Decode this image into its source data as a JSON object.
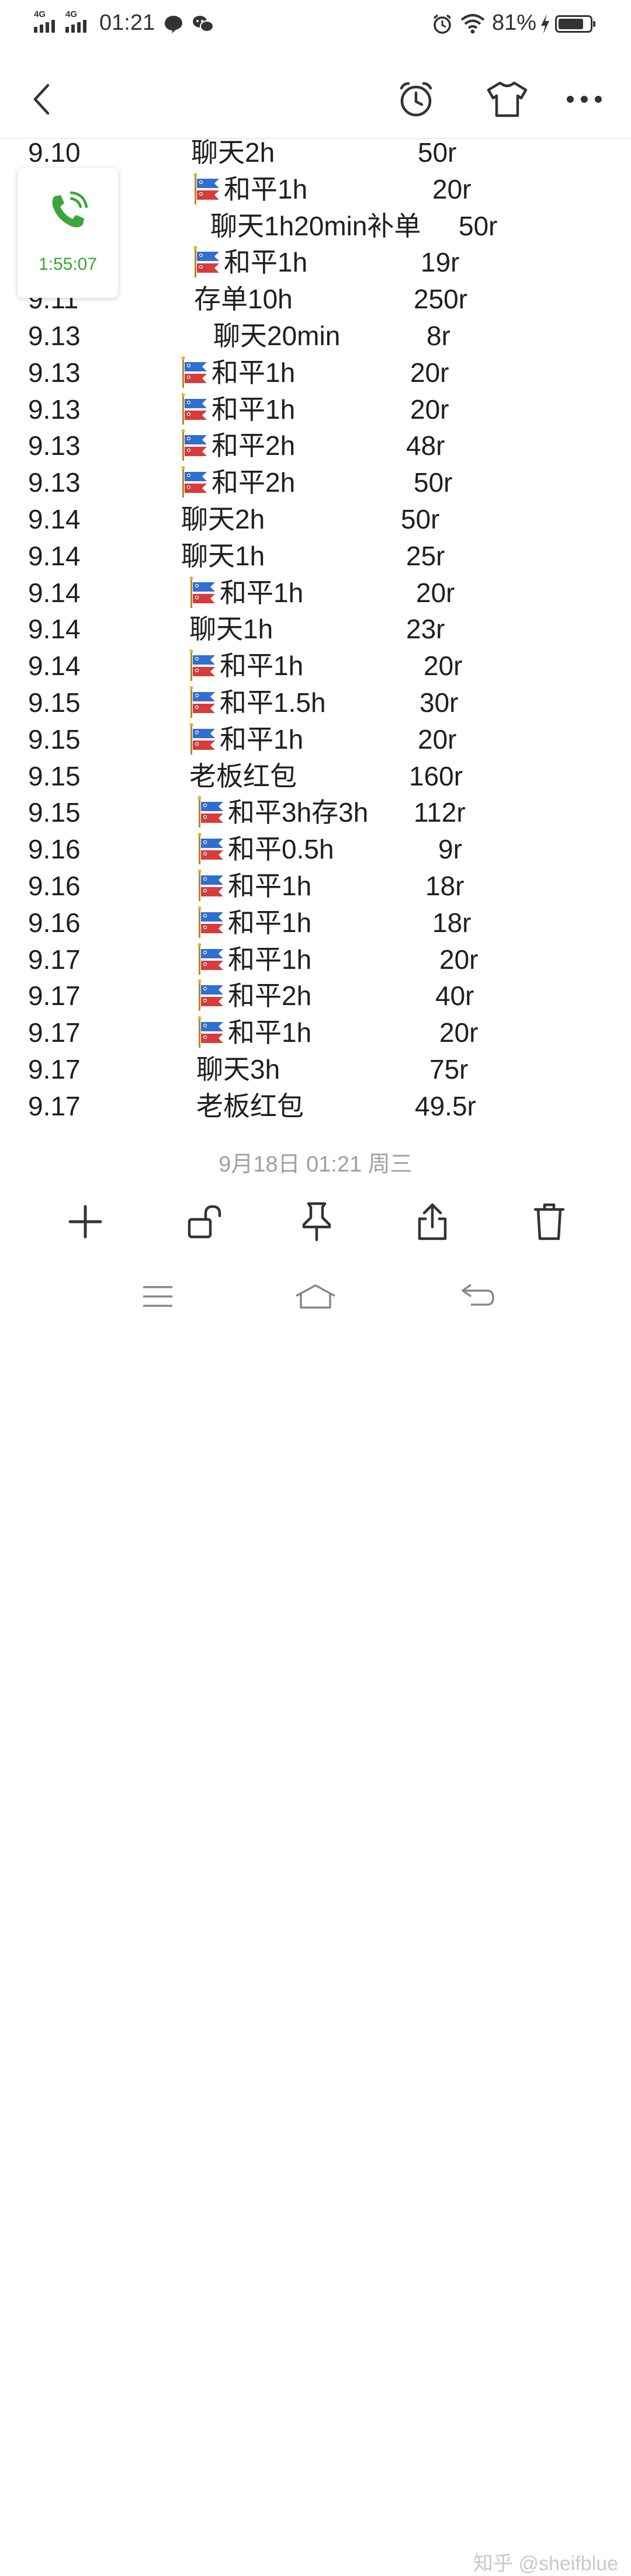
{
  "status_bar": {
    "network1": "4G",
    "network2": "4G",
    "time": "01:21",
    "battery_percent": "81%",
    "battery_level": 0.81
  },
  "call_widget": {
    "timer": "1:55:07",
    "accent": "#3aa53a"
  },
  "header_icons": [
    "back-arrow-icon",
    "alarm-clock-icon",
    "tshirt-icon",
    "more-dots-icon"
  ],
  "note": {
    "rows": [
      {
        "date": "9.10",
        "item": "聊天2h",
        "amount": "50r",
        "flag": false
      },
      {
        "date": "",
        "item": "和平1h",
        "amount": "20r",
        "flag": true
      },
      {
        "date": "",
        "item": "聊天1h20min补单",
        "amount": "50r",
        "flag": false
      },
      {
        "date": "",
        "item": "和平1h",
        "amount": "19r",
        "flag": true
      },
      {
        "date": "9.11",
        "item": "存单10h",
        "amount": "250r",
        "flag": false
      },
      {
        "date": "9.13",
        "item": "聊天20min",
        "amount": "8r",
        "flag": false
      },
      {
        "date": "9.13",
        "item": "和平1h",
        "amount": "20r",
        "flag": true
      },
      {
        "date": "9.13",
        "item": "和平1h",
        "amount": "20r",
        "flag": true
      },
      {
        "date": "9.13",
        "item": "和平2h",
        "amount": "48r",
        "flag": true
      },
      {
        "date": "9.13",
        "item": "和平2h",
        "amount": "50r",
        "flag": true
      },
      {
        "date": "9.14",
        "item": "聊天2h",
        "amount": "50r",
        "flag": false
      },
      {
        "date": "9.14",
        "item": "聊天1h",
        "amount": "25r",
        "flag": false
      },
      {
        "date": "9.14",
        "item": "和平1h",
        "amount": "20r",
        "flag": true
      },
      {
        "date": "9.14",
        "item": "聊天1h",
        "amount": "23r",
        "flag": false
      },
      {
        "date": "9.14",
        "item": "和平1h",
        "amount": "20r",
        "flag": true
      },
      {
        "date": "9.15",
        "item": "和平1.5h",
        "amount": "30r",
        "flag": true
      },
      {
        "date": "9.15",
        "item": "和平1h",
        "amount": "20r",
        "flag": true
      },
      {
        "date": "9.15",
        "item": "老板红包",
        "amount": "160r",
        "flag": false
      },
      {
        "date": "9.15",
        "item": "和平3h存3h",
        "amount": "112r",
        "flag": true
      },
      {
        "date": "9.16",
        "item": "和平0.5h",
        "amount": "9r",
        "flag": true
      },
      {
        "date": "9.16",
        "item": "和平1h",
        "amount": "18r",
        "flag": true
      },
      {
        "date": "9.16",
        "item": "和平1h",
        "amount": "18r",
        "flag": true
      },
      {
        "date": "9.17",
        "item": "和平1h",
        "amount": "20r",
        "flag": true
      },
      {
        "date": "9.17",
        "item": "和平2h",
        "amount": "40r",
        "flag": true
      },
      {
        "date": "9.17",
        "item": "和平1h",
        "amount": "20r",
        "flag": true
      },
      {
        "date": "9.17",
        "item": "聊天3h",
        "amount": "75r",
        "flag": false
      },
      {
        "date": "9.17",
        "item": "老板红包",
        "amount": "49.5r",
        "flag": false
      }
    ],
    "timestamp": "9月18日 01:21 周三"
  },
  "toolbar_icons": [
    "add-icon",
    "unlock-icon",
    "pin-icon",
    "share-icon",
    "trash-icon"
  ],
  "nav_icons": [
    "menu-icon",
    "home-icon",
    "back-icon"
  ],
  "watermark": "知乎 @sheifblue"
}
